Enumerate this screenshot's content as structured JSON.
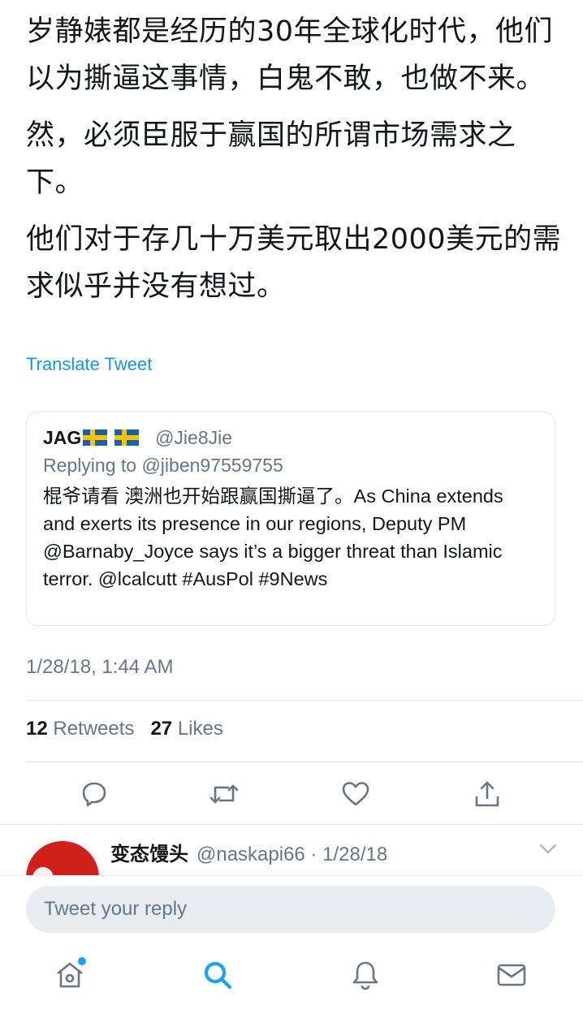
{
  "tweet": {
    "paragraphs": [
      "岁静婊都是经历的30年全球化时代，他们以为撕逼这事情，白鬼不敢，也做不来。",
      "然，必须臣服于赢国的所谓市场需求之下。",
      "他们对于存几十万美元取出2000美元的需求似乎并没有想过。"
    ],
    "translate_label": "Translate Tweet",
    "timestamp": "1/28/18, 1:44 AM",
    "retweets_count": "12",
    "retweets_label": "Retweets",
    "likes_count": "27",
    "likes_label": "Likes"
  },
  "quoted": {
    "name": "JAG",
    "handle": "@Jie8Jie",
    "replying_to": "Replying to @jiben97559755",
    "text": "棍爷请看 澳洲也开始跟赢国撕逼了。As China extends and exerts its presence in our regions, Deputy PM @Barnaby_Joyce says it’s a bigger threat than Islamic terror. @lcalcutt  #AusPol #9News"
  },
  "reply": {
    "name": "变态馒头",
    "meta": "@naskapi66 · 1/28/18"
  },
  "composer": {
    "placeholder": "Tweet your reply"
  },
  "colors": {
    "link": "#1b95e0",
    "accent": "#1da1f2",
    "secondary": "#657786"
  },
  "icons": [
    "reply-icon",
    "retweet-icon",
    "like-icon",
    "share-icon",
    "chevron-down-icon",
    "home-icon",
    "search-icon",
    "notifications-icon",
    "messages-icon"
  ]
}
